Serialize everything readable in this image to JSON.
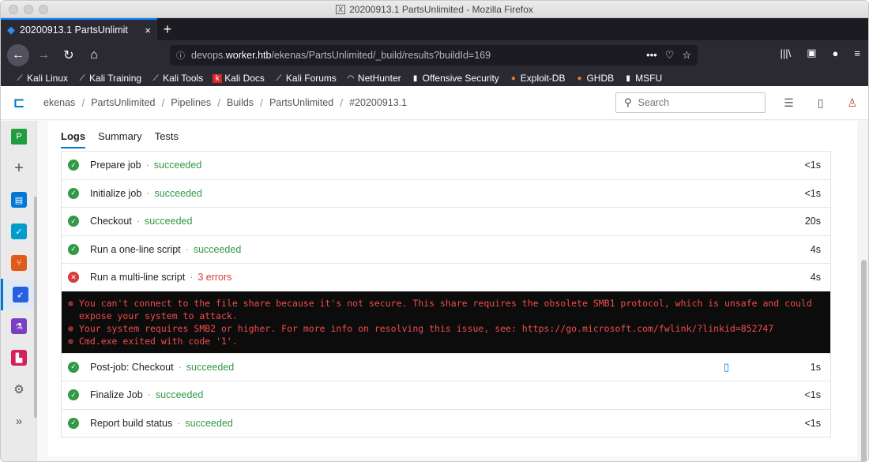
{
  "window": {
    "title": "20200913.1 PartsUnlimited - Mozilla Firefox"
  },
  "browser": {
    "tab": {
      "title": "20200913.1 PartsUnlimit",
      "close": "×"
    },
    "new_tab": "+",
    "url": {
      "prefix": "devops.",
      "domain": "worker.htb",
      "path": "/ekenas/PartsUnlimited/_build/results?buildId=169"
    },
    "bookmarks": [
      "Kali Linux",
      "Kali Training",
      "Kali Tools",
      "Kali Docs",
      "Kali Forums",
      "NetHunter",
      "Offensive Security",
      "Exploit-DB",
      "GHDB",
      "MSFU"
    ]
  },
  "devops": {
    "breadcrumbs": [
      "ekenas",
      "PartsUnlimited",
      "Pipelines",
      "Builds",
      "PartsUnlimited",
      "#20200913.1"
    ],
    "search_placeholder": "Search",
    "project_initial": "P",
    "subtabs": [
      "Logs",
      "Summary",
      "Tests"
    ],
    "steps_before": [
      {
        "name": "Prepare job",
        "status": "succeeded",
        "duration": "<1s"
      },
      {
        "name": "Initialize job",
        "status": "succeeded",
        "duration": "<1s"
      },
      {
        "name": "Checkout",
        "status": "succeeded",
        "duration": "20s"
      },
      {
        "name": "Run a one-line script",
        "status": "succeeded",
        "duration": "4s"
      }
    ],
    "failed_step": {
      "name": "Run a multi-line script",
      "status": "3 errors",
      "duration": "4s"
    },
    "log_lines": [
      "You can't connect to the file share because it's not secure. This share requires the obsolete SMB1 protocol, which is unsafe and could expose your system to attack.",
      "Your system requires SMB2 or higher. For more info on resolving this issue, see: https://go.microsoft.com/fwlink/?linkid=852747",
      "Cmd.exe exited with code '1'."
    ],
    "steps_after": [
      {
        "name": "Post-job: Checkout",
        "status": "succeeded",
        "duration": "1s"
      },
      {
        "name": "Finalize Job",
        "status": "succeeded",
        "duration": "<1s"
      },
      {
        "name": "Report build status",
        "status": "succeeded",
        "duration": "<1s"
      }
    ]
  },
  "colors": {
    "success": "#339947",
    "error": "#d53b3b",
    "accent": "#0078d4"
  }
}
